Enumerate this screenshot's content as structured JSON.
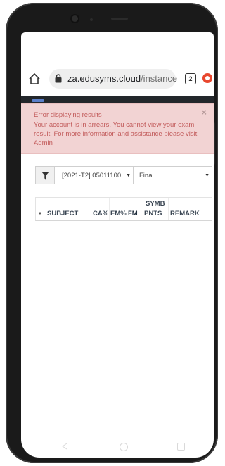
{
  "browser": {
    "url_host": "za.edusyms.cloud",
    "url_path": "/instance",
    "tab_count": "2"
  },
  "alert": {
    "title": "Error displaying results",
    "message": "Your account is in arrears. You cannot view your exam result. For more information and assistance please visit Admin",
    "close": "×"
  },
  "filters": {
    "term_select": "[2021-T2] 05011100",
    "exam_select": "Final"
  },
  "table": {
    "columns": [
      "SUBJECT",
      "CA%",
      "EM%",
      "FM",
      "SYMB",
      "PNTS",
      "REMARK"
    ]
  },
  "colors": {
    "alert_bg": "#f2d3d3",
    "alert_text": "#c25b5b",
    "header_dark": "#23272b"
  }
}
